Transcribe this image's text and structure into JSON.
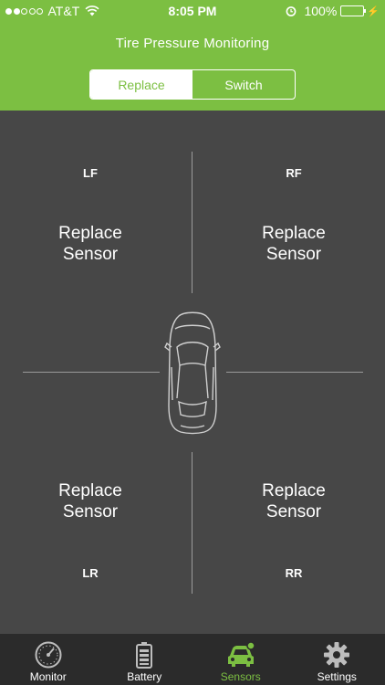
{
  "status_bar": {
    "carrier": "AT&T",
    "time": "8:05 PM",
    "battery_percent": "100%",
    "signal_bars_filled": 2,
    "signal_bars_total": 5
  },
  "header": {
    "title": "Tire Pressure Monitoring",
    "segments": [
      {
        "label": "Replace",
        "selected": true
      },
      {
        "label": "Switch",
        "selected": false
      }
    ],
    "accent_color": "#7cbf42"
  },
  "sensors": {
    "lf": {
      "position": "LF",
      "action": [
        "Replace",
        "Sensor"
      ]
    },
    "rf": {
      "position": "RF",
      "action": [
        "Replace",
        "Sensor"
      ]
    },
    "lr": {
      "position": "LR",
      "action": [
        "Replace",
        "Sensor"
      ]
    },
    "rr": {
      "position": "RR",
      "action": [
        "Replace",
        "Sensor"
      ]
    }
  },
  "tabbar": {
    "tabs": [
      {
        "label": "Monitor",
        "icon": "speedometer-icon",
        "active": false
      },
      {
        "label": "Battery",
        "icon": "battery-icon",
        "active": false
      },
      {
        "label": "Sensors",
        "icon": "car-sensor-icon",
        "active": true
      },
      {
        "label": "Settings",
        "icon": "gear-icon",
        "active": false
      }
    ]
  }
}
